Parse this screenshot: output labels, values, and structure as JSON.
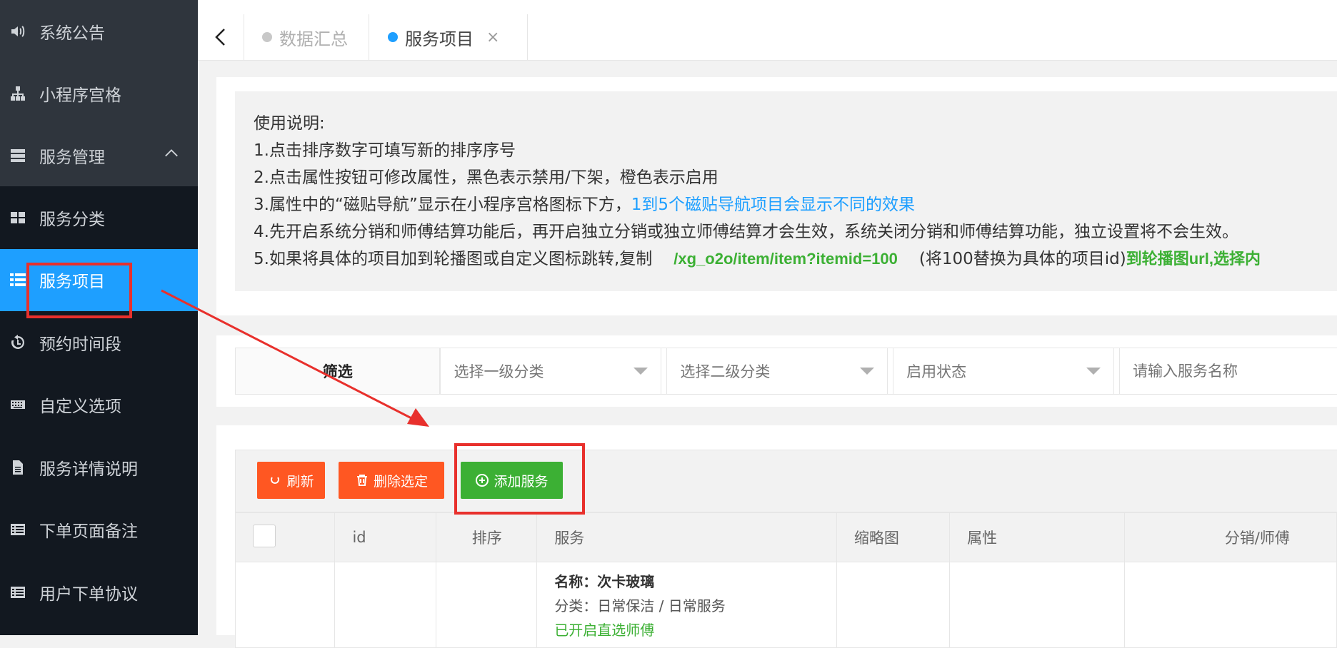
{
  "sidebar": {
    "top_items": [
      {
        "label": "系统公告",
        "icon": "speaker-icon"
      },
      {
        "label": "小程序宫格",
        "icon": "sitemap-icon"
      },
      {
        "label": "服务管理",
        "icon": "server-icon"
      }
    ],
    "sub_items": [
      {
        "label": "服务分类",
        "icon": "grid-icon"
      },
      {
        "label": "服务项目",
        "icon": "list-icon",
        "active": true
      },
      {
        "label": "预约时间段",
        "icon": "history-icon"
      },
      {
        "label": "自定义选项",
        "icon": "keyboard-icon"
      },
      {
        "label": "服务详情说明",
        "icon": "file-icon"
      },
      {
        "label": "下单页面备注",
        "icon": "list-alt-icon"
      },
      {
        "label": "用户下单协议",
        "icon": "list-alt-icon"
      }
    ]
  },
  "tabs": [
    {
      "label": "数据汇总"
    },
    {
      "label": "服务项目",
      "close": "×"
    }
  ],
  "notice": {
    "title": "使用说明:",
    "line1": "1.点击排序数字可填写新的排序序号",
    "line2": "2.点击属性按钮可修改属性，黑色表示禁用/下架，橙色表示启用",
    "line3": "3.属性中的“磁贴导航”显示在小程序宫格图标下方，",
    "line3_blue": "1到5个磁贴导航项目会显示不同的效果",
    "line4": "4.先开启系统分销和师傅结算功能后，再开启独立分销或独立师傅结算才会生效，系统关闭分销和师傅结算功能，独立设置将不会生效。",
    "line5_a": "5.如果将具体的项目加到轮播图或自定义图标跳转,复制",
    "line5_path": "/xg_o2o/item/item?itemid=100",
    "line5_b": "(将100替换为具体的项目id)",
    "line5_green": "到轮播图url,选择内"
  },
  "filter": {
    "label": "筛选",
    "select1": "选择一级分类",
    "select2": "选择二级分类",
    "select3": "启用状态",
    "search_placeholder": "请输入服务名称"
  },
  "toolbar": {
    "refresh": "刷新",
    "delete": "删除选定",
    "add": "添加服务"
  },
  "table": {
    "headers": [
      "",
      "id",
      "排序",
      "服务",
      "缩略图",
      "属性",
      "分销/师傅"
    ],
    "row1": {
      "name": "名称：次卡玻璃",
      "category": "分类：日常保洁 / 日常服务",
      "status": "已开启直选师傅"
    }
  },
  "colors": {
    "accent": "#1e9fff",
    "danger": "#ff5722",
    "success": "#3cb034",
    "annotation": "#e8302c"
  }
}
